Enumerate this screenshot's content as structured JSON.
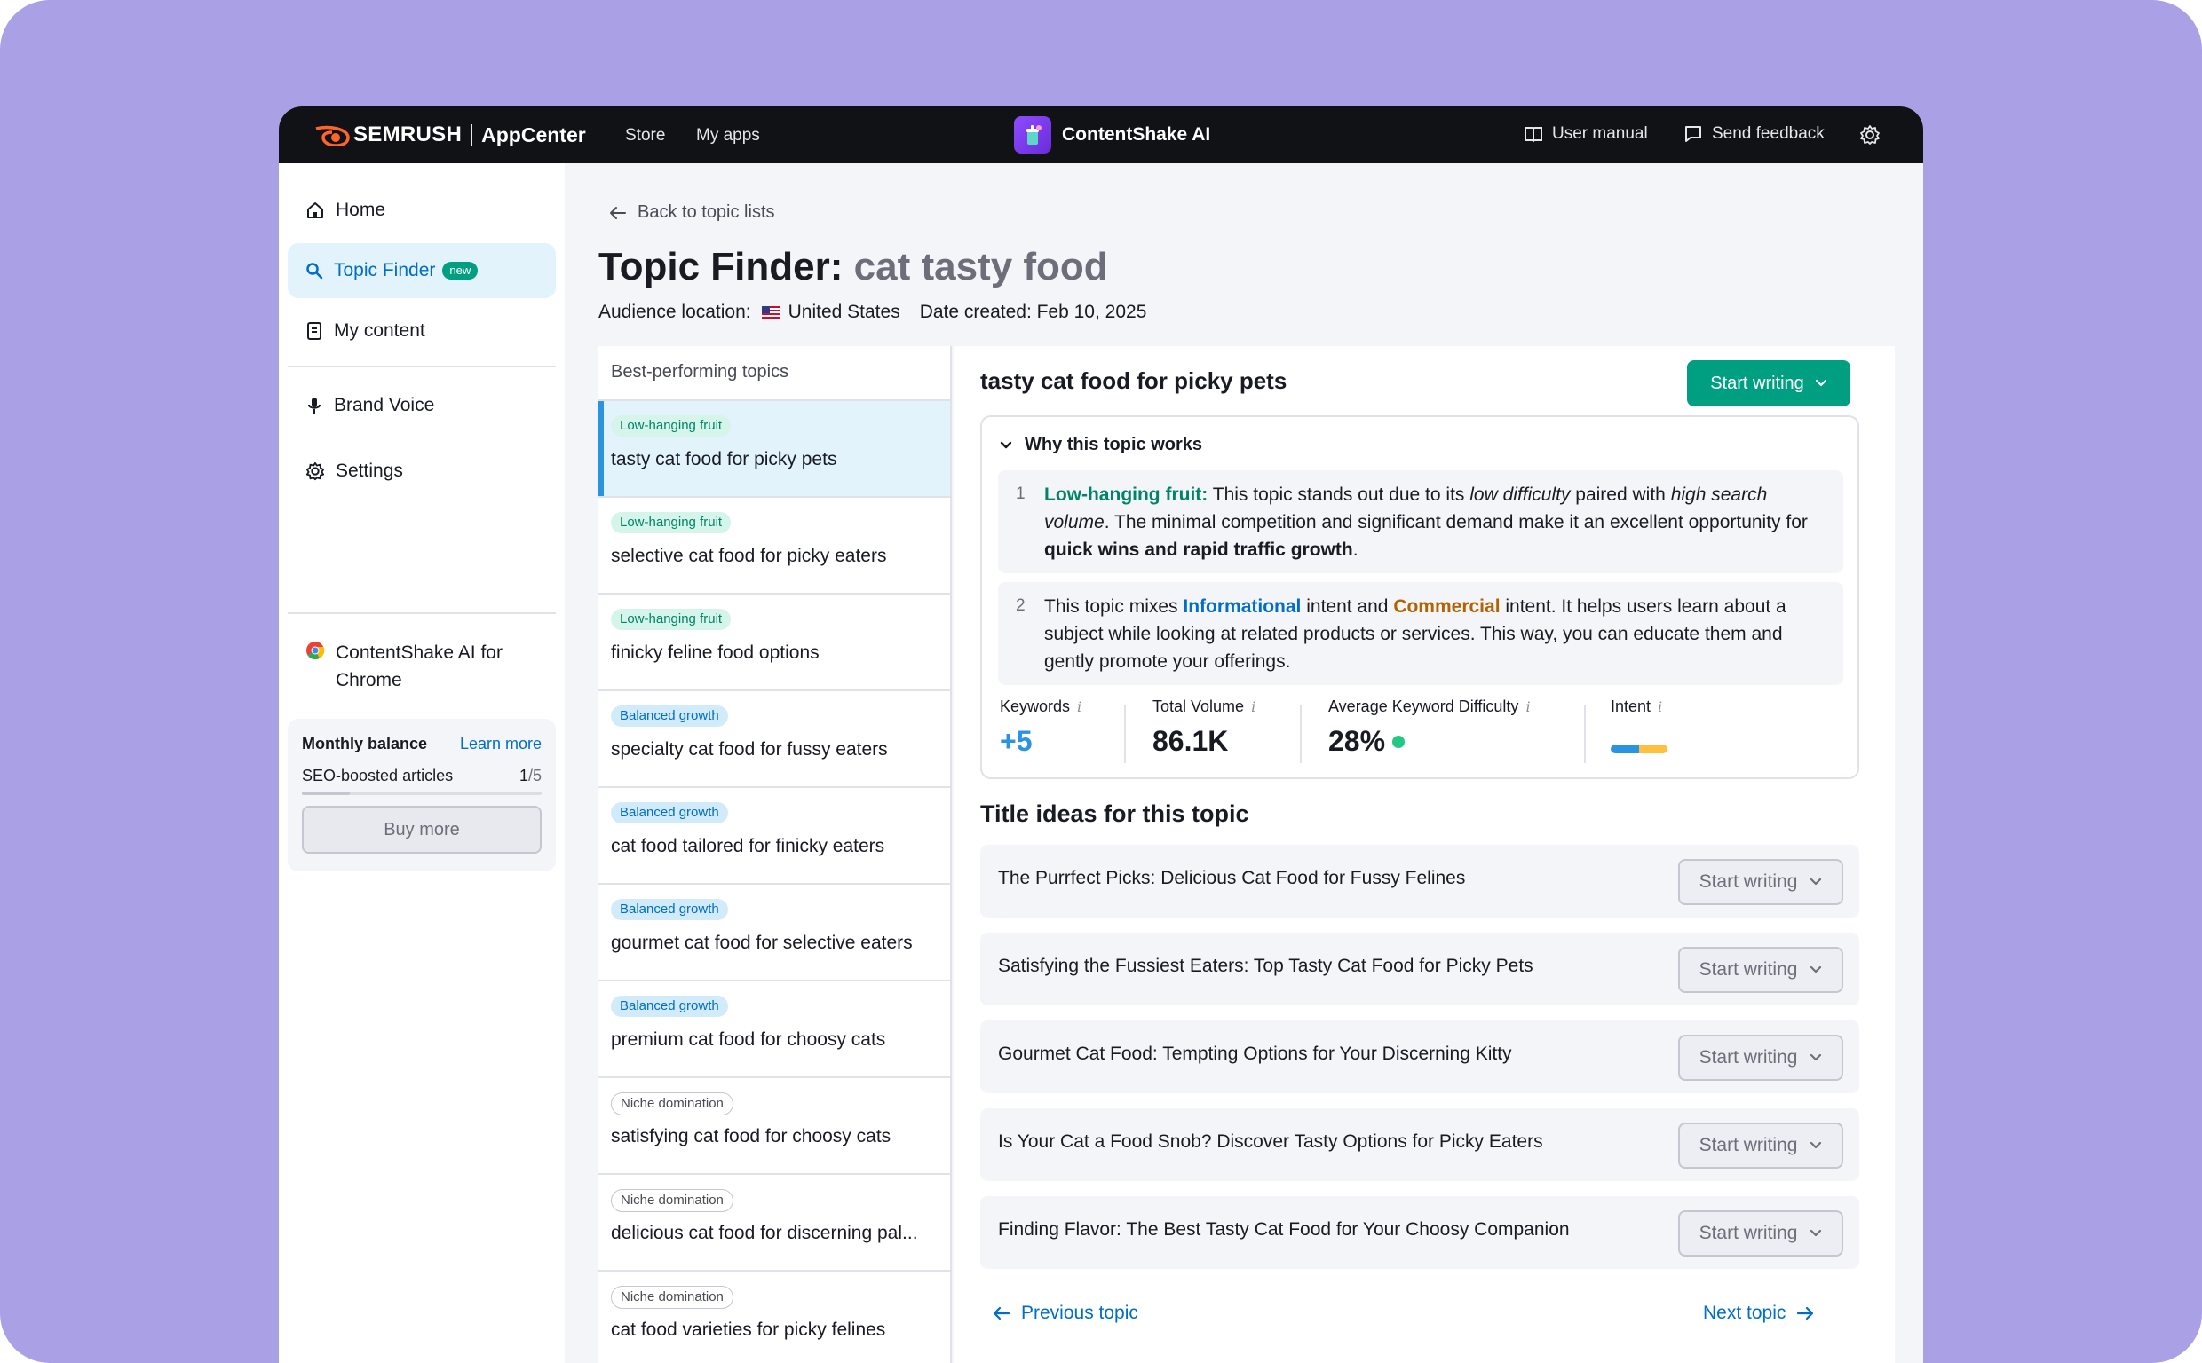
{
  "topbar": {
    "brand_word": "SEMRUSH",
    "brand_app": "AppCenter",
    "nav": [
      "Store",
      "My apps"
    ],
    "app_name": "ContentShake AI",
    "user_manual": "User manual",
    "send_feedback": "Send feedback"
  },
  "sidebar": {
    "home": "Home",
    "topic_finder": "Topic Finder",
    "badge_new": "new",
    "my_content": "My content",
    "brand_voice": "Brand Voice",
    "settings": "Settings",
    "chrome_ext": "ContentShake AI for Chrome",
    "balance": {
      "title": "Monthly balance",
      "learn_more": "Learn more",
      "label": "SEO-boosted articles",
      "used": "1",
      "total": "/5",
      "used_fraction": 0.2,
      "buy_more": "Buy more"
    }
  },
  "page": {
    "back": "Back to topic lists",
    "title_prefix": "Topic Finder:",
    "title_keyword": "cat tasty food",
    "audience_label": "Audience location:",
    "audience_value": "United States",
    "date_created": "Date created: Feb 10, 2025"
  },
  "topics": {
    "header": "Best-performing topics",
    "items": [
      {
        "tag": "Low-hanging fruit",
        "title": "tasty cat food for picky pets"
      },
      {
        "tag": "Low-hanging fruit",
        "title": "selective cat food for picky eaters"
      },
      {
        "tag": "Low-hanging fruit",
        "title": "finicky feline food options"
      },
      {
        "tag": "Balanced growth",
        "title": "specialty cat food for fussy eaters"
      },
      {
        "tag": "Balanced growth",
        "title": "cat food tailored for finicky eaters"
      },
      {
        "tag": "Balanced growth",
        "title": "gourmet cat food for selective eaters"
      },
      {
        "tag": "Balanced growth",
        "title": "premium cat food for choosy cats"
      },
      {
        "tag": "Niche domination",
        "title": "satisfying cat food for choosy cats"
      },
      {
        "tag": "Niche domination",
        "title": "delicious cat food for discerning pal..."
      },
      {
        "tag": "Niche domination",
        "title": "cat food varieties for picky felines"
      }
    ]
  },
  "detail": {
    "title": "tasty cat food for picky pets",
    "start_writing": "Start writing",
    "why_title": "Why this topic works",
    "reason1": {
      "num": "1",
      "lead": "Low-hanging fruit:",
      "a": " This topic stands out due to its ",
      "b": "low difficulty",
      "c": " paired with ",
      "d": "high search volume",
      "e": ". The minimal competition and significant demand make it an excellent opportunity for ",
      "f": "quick wins and rapid traffic growth",
      "g": "."
    },
    "reason2": {
      "num": "2",
      "a": "This topic mixes ",
      "b": "Informational",
      "c": " intent and ",
      "d": "Commercial",
      "e": " intent. It helps users learn about a subject while looking at related products or services. This way, you can educate them and gently promote your offerings."
    },
    "stats": {
      "keywords_label": "Keywords",
      "keywords_value": "+5",
      "volume_label": "Total Volume",
      "volume_value": "86.1K",
      "difficulty_label": "Average Keyword Difficulty",
      "difficulty_value": "28%",
      "intent_label": "Intent",
      "info_glyph": "i"
    },
    "ideas_title": "Title ideas for this topic",
    "ideas": [
      "The Purrfect Picks: Delicious Cat Food for Fussy Felines",
      "Satisfying the Fussiest Eaters: Top Tasty Cat Food for Picky Pets",
      "Gourmet Cat Food: Tempting Options for Your Discerning Kitty",
      "Is Your Cat a Food Snob? Discover Tasty Options for Picky Eaters",
      "Finding Flavor: The Best Tasty Cat Food for Your Choosy Companion"
    ],
    "prev_topic": "Previous topic",
    "next_topic": "Next topic"
  },
  "colors": {
    "background": "#a9a0e6",
    "accent_green": "#009f81",
    "link_blue": "#006dca",
    "intent_informational": "#2b94e1",
    "intent_commercial": "#ffbf3f"
  }
}
